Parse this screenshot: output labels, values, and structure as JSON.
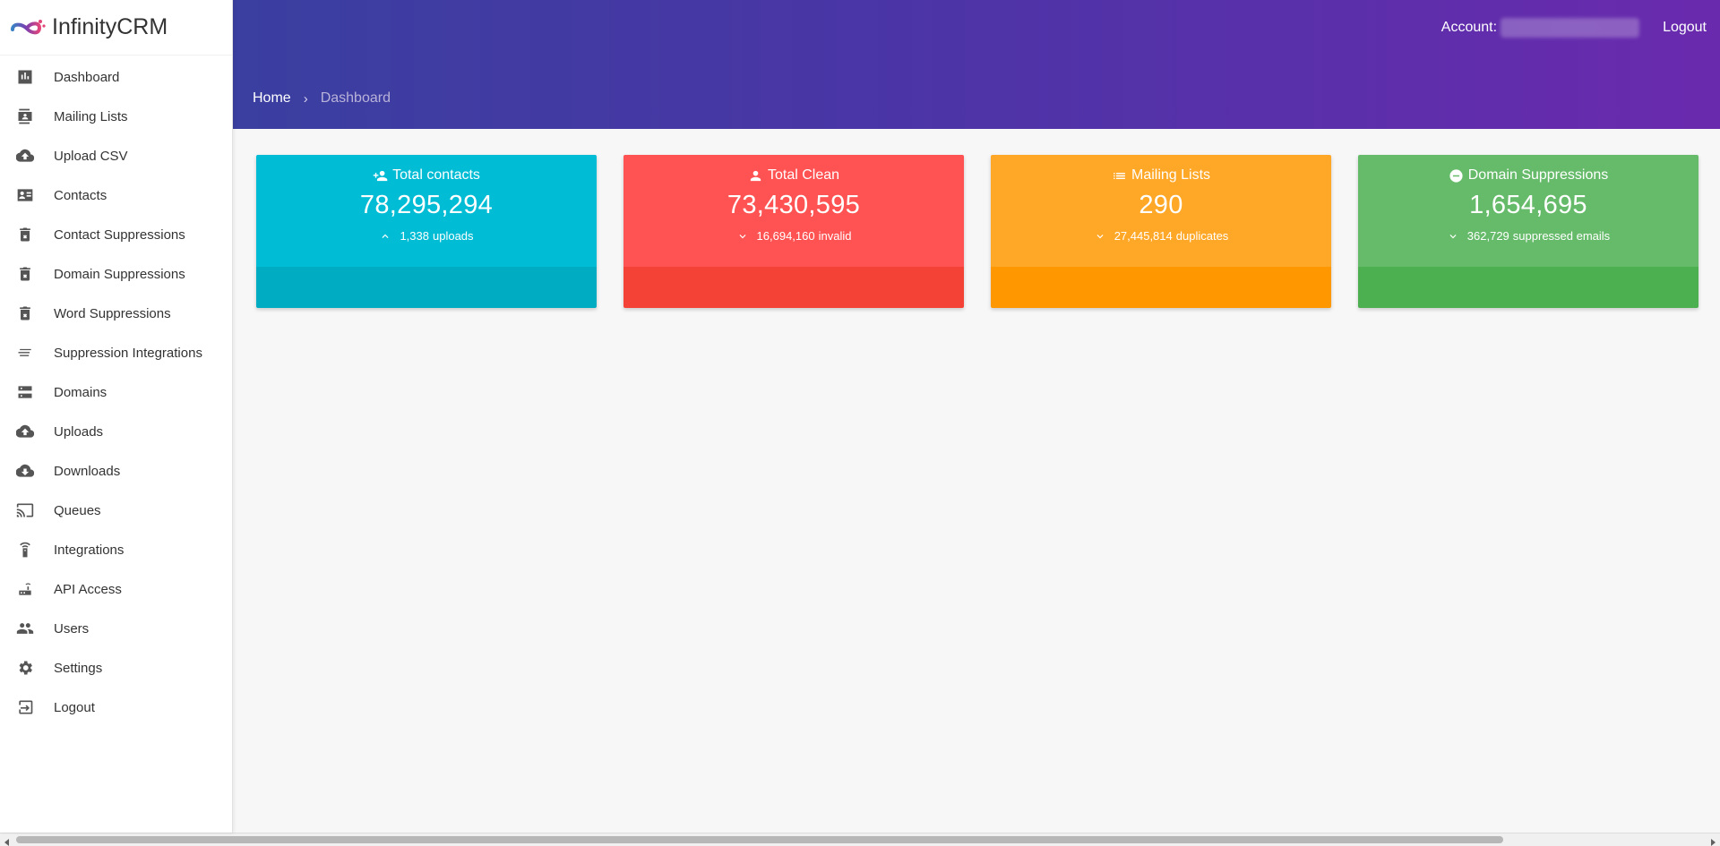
{
  "app": {
    "name": "InfinityCRM"
  },
  "sidebar": {
    "items": [
      {
        "label": "Dashboard",
        "icon": "bar-chart-icon"
      },
      {
        "label": "Mailing Lists",
        "icon": "contact-book-icon"
      },
      {
        "label": "Upload CSV",
        "icon": "cloud-upload-icon"
      },
      {
        "label": "Contacts",
        "icon": "contact-card-icon"
      },
      {
        "label": "Contact Suppressions",
        "icon": "trash-x-icon"
      },
      {
        "label": "Domain Suppressions",
        "icon": "trash-x-icon"
      },
      {
        "label": "Word Suppressions",
        "icon": "trash-x-icon"
      },
      {
        "label": "Suppression Integrations",
        "icon": "lines-icon"
      },
      {
        "label": "Domains",
        "icon": "server-icon"
      },
      {
        "label": "Uploads",
        "icon": "cloud-upload-icon"
      },
      {
        "label": "Downloads",
        "icon": "cloud-download-icon"
      },
      {
        "label": "Queues",
        "icon": "cast-icon"
      },
      {
        "label": "Integrations",
        "icon": "remote-icon"
      },
      {
        "label": "API Access",
        "icon": "router-icon"
      },
      {
        "label": "Users",
        "icon": "users-icon"
      },
      {
        "label": "Settings",
        "icon": "gear-icon"
      },
      {
        "label": "Logout",
        "icon": "logout-icon"
      }
    ]
  },
  "header": {
    "account_label": "Account:",
    "logout_label": "Logout",
    "breadcrumb": {
      "home": "Home",
      "separator": "›",
      "current": "Dashboard"
    }
  },
  "cards": [
    {
      "title": "Total contacts",
      "icon": "person-add-icon",
      "value": "78,295,294",
      "sub_number": "1,338",
      "sub_text": "uploads",
      "trend": "up",
      "color_top": "#00bcd4",
      "color_bottom": "#00acc1"
    },
    {
      "title": "Total Clean",
      "icon": "person-icon",
      "value": "73,430,595",
      "sub_number": "16,694,160",
      "sub_text": "invalid",
      "trend": "down",
      "color_top": "#ff5252",
      "color_bottom": "#f44336"
    },
    {
      "title": "Mailing Lists",
      "icon": "list-icon",
      "value": "290",
      "sub_number": "27,445,814",
      "sub_text": "duplicates",
      "trend": "down",
      "color_top": "#ffa726",
      "color_bottom": "#ff9800"
    },
    {
      "title": "Domain Suppressions",
      "icon": "minus-circle-icon",
      "value": "1,654,695",
      "sub_number": "362,729",
      "sub_text": "suppressed emails",
      "trend": "down",
      "color_top": "#66bb6a",
      "color_bottom": "#4caf50"
    }
  ],
  "colors": {
    "header_gradient_start": "#3a3fa0",
    "header_gradient_end": "#6a2aae",
    "background": "#f7f7f7"
  }
}
